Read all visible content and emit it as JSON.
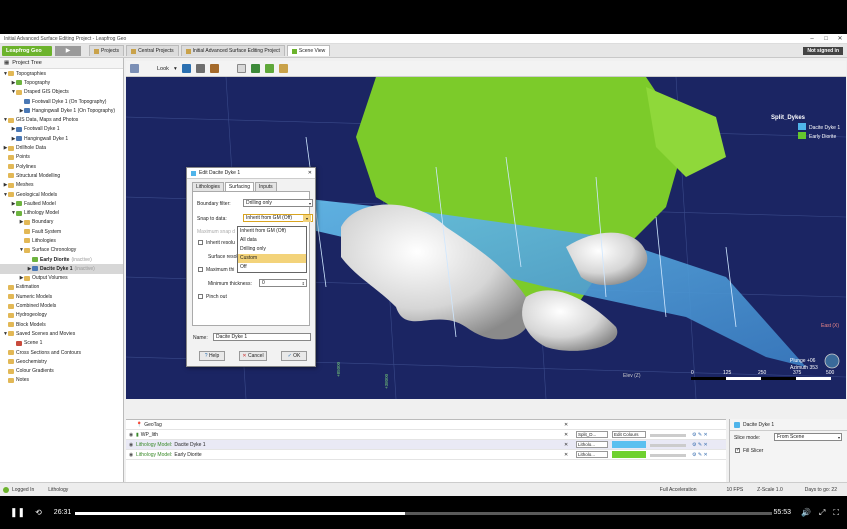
{
  "window": {
    "title": "Initial Advanced Surface Editing Project - Leapfrog Geo"
  },
  "topbar": {
    "app_button": "Leapfrog Geo",
    "play_symbol": "▶",
    "sign_in": "Not signed in",
    "tabs": [
      "Projects",
      "Central Projects",
      "Initial Advanced Surface Editing Project",
      "Scene View"
    ],
    "active_tab": 3
  },
  "viewtool": {
    "look_label": "Look"
  },
  "tree": {
    "header": "Project Tree",
    "rows": [
      {
        "label": "Topographies",
        "ind": 0,
        "tw": "▼",
        "ic": ""
      },
      {
        "label": "Topography",
        "ind": 1,
        "tw": "▶",
        "ic": "g"
      },
      {
        "label": "Draped GIS Objects",
        "ind": 1,
        "tw": "▼",
        "ic": ""
      },
      {
        "label": "Footwall Dyke 1 (On Topography)",
        "ind": 2,
        "tw": "",
        "ic": "b"
      },
      {
        "label": "Hangingwall Dyke 1 (On Topography)",
        "ind": 2,
        "tw": "▶",
        "ic": "b"
      },
      {
        "label": "GIS Data, Maps and Photos",
        "ind": 0,
        "tw": "▼",
        "ic": ""
      },
      {
        "label": "Footwall Dyke 1",
        "ind": 1,
        "tw": "▶",
        "ic": "b"
      },
      {
        "label": "Hangingwall Dyke 1",
        "ind": 1,
        "tw": "▶",
        "ic": "b"
      },
      {
        "label": "Drillhole Data",
        "ind": 0,
        "tw": "▶",
        "ic": ""
      },
      {
        "label": "Points",
        "ind": 0,
        "tw": "",
        "ic": ""
      },
      {
        "label": "Polylines",
        "ind": 0,
        "tw": "",
        "ic": ""
      },
      {
        "label": "Structural Modelling",
        "ind": 0,
        "tw": "",
        "ic": ""
      },
      {
        "label": "Meshes",
        "ind": 0,
        "tw": "▶",
        "ic": ""
      },
      {
        "label": "Geological Models",
        "ind": 0,
        "tw": "▼",
        "ic": ""
      },
      {
        "label": "Faulted Model",
        "ind": 1,
        "tw": "▶",
        "ic": "g"
      },
      {
        "label": "Lithology Model",
        "ind": 1,
        "tw": "▼",
        "ic": "g"
      },
      {
        "label": "Boundary",
        "ind": 2,
        "tw": "▶",
        "ic": ""
      },
      {
        "label": "Fault System",
        "ind": 2,
        "tw": "",
        "ic": ""
      },
      {
        "label": "Lithologies",
        "ind": 2,
        "tw": "",
        "ic": ""
      },
      {
        "label": "Surface Chronology",
        "ind": 2,
        "tw": "▼",
        "ic": ""
      },
      {
        "label": "Early Diorite",
        "ind": 3,
        "tw": "",
        "ic": "g",
        "note": "(inactive)",
        "bold": true
      },
      {
        "label": "Dacite Dyke 1",
        "ind": 3,
        "tw": "▶",
        "ic": "b",
        "note": "(inactive)",
        "bold": true,
        "sel": true
      },
      {
        "label": "Output Volumes",
        "ind": 2,
        "tw": "▶",
        "ic": ""
      },
      {
        "label": "Estimation",
        "ind": 0,
        "tw": "",
        "ic": ""
      },
      {
        "label": "Numeric Models",
        "ind": 0,
        "tw": "",
        "ic": ""
      },
      {
        "label": "Combined Models",
        "ind": 0,
        "tw": "",
        "ic": ""
      },
      {
        "label": "Hydrogeology",
        "ind": 0,
        "tw": "",
        "ic": ""
      },
      {
        "label": "Block Models",
        "ind": 0,
        "tw": "",
        "ic": ""
      },
      {
        "label": "Saved Scenes and Movies",
        "ind": 0,
        "tw": "▼",
        "ic": ""
      },
      {
        "label": "Scene 1",
        "ind": 1,
        "tw": "",
        "ic": "r"
      },
      {
        "label": "Cross Sections and Contours",
        "ind": 0,
        "tw": "",
        "ic": ""
      },
      {
        "label": "Geochemistry",
        "ind": 0,
        "tw": "",
        "ic": ""
      },
      {
        "label": "Colour Gradients",
        "ind": 0,
        "tw": "",
        "ic": ""
      },
      {
        "label": "Notes",
        "ind": 0,
        "tw": "",
        "ic": ""
      }
    ]
  },
  "scene": {
    "legend_title": "Split_Dykes",
    "legend": [
      {
        "label": "Dacite Dyke 1",
        "color": "#4fb4ea"
      },
      {
        "label": "Early Diorite",
        "color": "#66c52e"
      }
    ],
    "scale_ticks": [
      "0",
      "125",
      "250",
      "375",
      "500"
    ],
    "plunge": "Plunge +06",
    "azimuth": "Azimuth 353",
    "east_label": "East (X)",
    "elev_label": "Elev (Z)",
    "north_label": "+85000",
    "north_label_2": "+38000"
  },
  "dialog": {
    "title": "Edit Dacite Dyke 1",
    "tabs": [
      "Lithologies",
      "Surfacing",
      "Inputs"
    ],
    "boundary_filter_label": "Boundary filter:",
    "boundary_filter_value": "Drilling only",
    "snap_label": "Snap to data:",
    "snap_value": "Inherit from GM (Off)",
    "snap_options": [
      "Inherit from GM (Off)",
      "All data",
      "Drilling only",
      "Custom",
      "Off"
    ],
    "max_snap_label": "Maximum snap d",
    "inherit_resolution_label": "Inherit resolu",
    "surface_resolution_label": "Surface resol",
    "max_thickness_label": "Maximum thi",
    "min_thickness_label": "Minimum thickness:",
    "min_thickness_value": "0",
    "pinch_out_label": "Pinch out",
    "name_label": "Name:",
    "name_value": "Dacite Dyke 1",
    "help": "Help",
    "cancel": "Cancel",
    "ok": "OK"
  },
  "shapes": {
    "rows": [
      {
        "label": "GeoTag",
        "prefix": "",
        "combo": "",
        "colour": ""
      },
      {
        "label": "WP_lith",
        "prefix": "",
        "combo": "Split_D...",
        "colour": "Edit Colours"
      },
      {
        "label": "Dacite Dyke 1",
        "prefix": "Lithology Model:",
        "combo": "Litholo...",
        "colour": "#5bc0f0"
      },
      {
        "label": "Early Diorite",
        "prefix": "Lithology Model:",
        "combo": "Litholo...",
        "colour": "#6fd12f"
      }
    ]
  },
  "props": {
    "title": "Dacite Dyke 1",
    "slice_label": "Slice mode:",
    "slice_value": "From Scene",
    "fill_slicer": "Fill Slicer"
  },
  "status": {
    "logged": "Logged In",
    "lithology": "Lithology",
    "accel": "Full Acceleration",
    "fps": "10 FPS",
    "zscale": "Z-Scale 1.0",
    "days": "Days to go: 22"
  },
  "video": {
    "current": "26:31",
    "total": "55:53",
    "progress": 0.474
  }
}
